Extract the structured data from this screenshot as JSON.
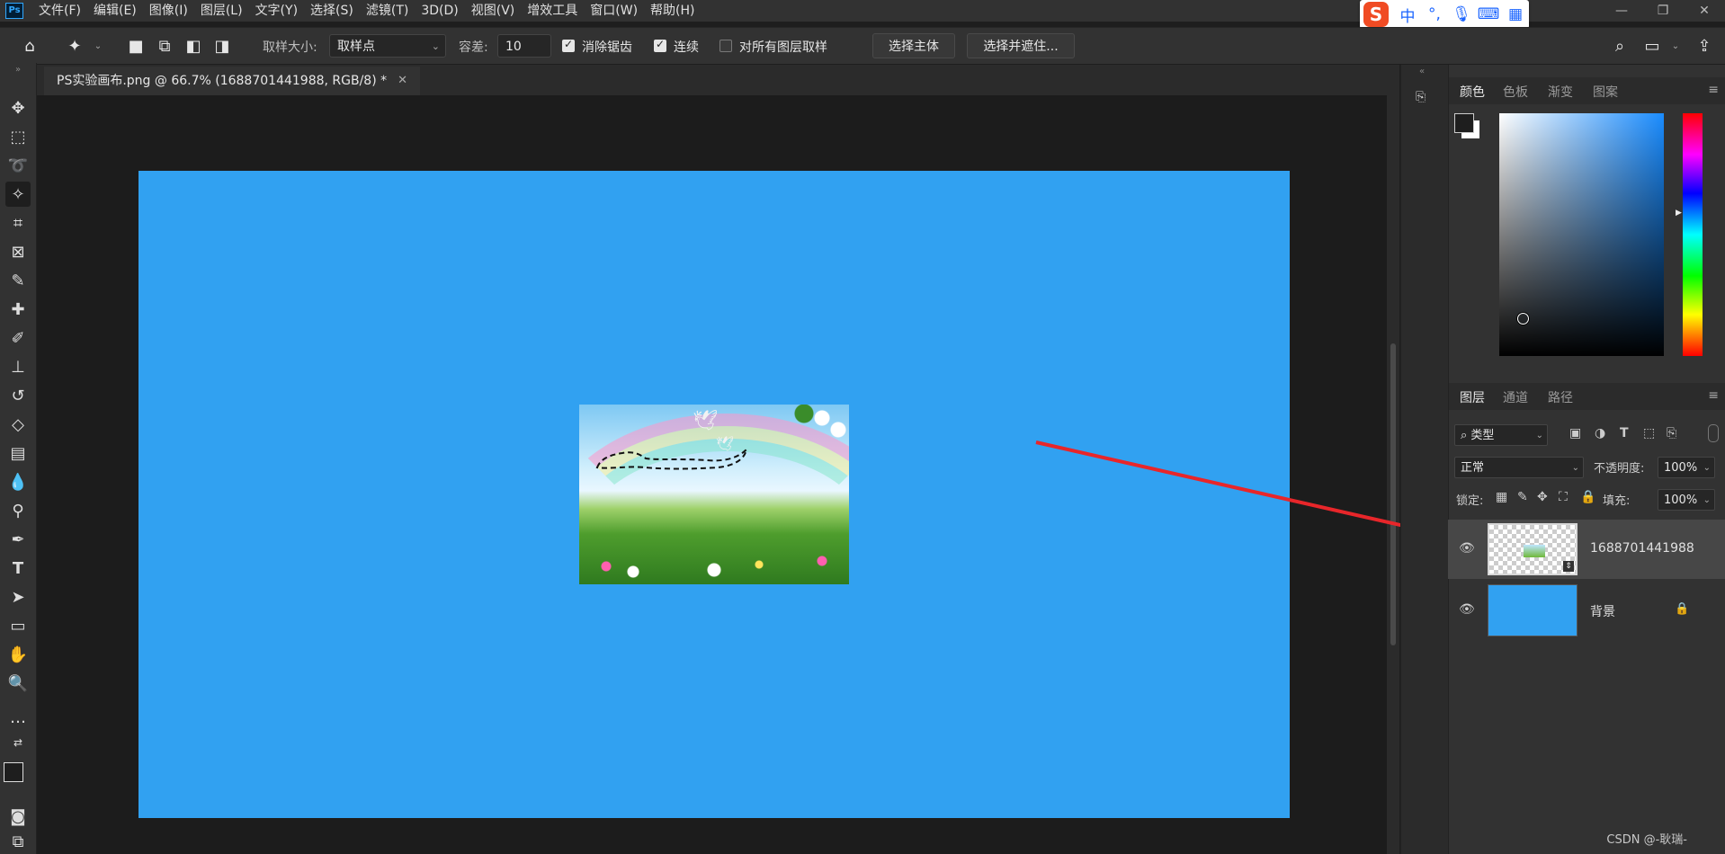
{
  "app": {
    "logo": "Ps"
  },
  "menu": [
    "文件(F)",
    "编辑(E)",
    "图像(I)",
    "图层(L)",
    "文字(Y)",
    "选择(S)",
    "滤镜(T)",
    "3D(D)",
    "视图(V)",
    "增效工具",
    "窗口(W)",
    "帮助(H)"
  ],
  "ime": {
    "logo": "S",
    "lang": "中",
    "punct": "°,"
  },
  "options": {
    "sample_size_label": "取样大小:",
    "sample_size_value": "取样点",
    "tolerance_label": "容差:",
    "tolerance_value": "10",
    "anti_alias_label": "消除锯齿",
    "anti_alias_checked": true,
    "contiguous_label": "连续",
    "contiguous_checked": true,
    "sample_all_label": "对所有图层取样",
    "sample_all_checked": false,
    "select_subject": "选择主体",
    "select_mask": "选择并遮住..."
  },
  "document": {
    "tab_title": "PS实验画布.png @ 66.7% (1688701441988, RGB/8) *",
    "canvas_color": "#31a1f1"
  },
  "color_panel": {
    "tabs": [
      "颜色",
      "色板",
      "渐变",
      "图案"
    ],
    "active": 0
  },
  "layers_panel": {
    "tabs": [
      "图层",
      "通道",
      "路径"
    ],
    "active": 0,
    "filter": "类型",
    "blend_mode": "正常",
    "opacity_label": "不透明度:",
    "opacity_value": "100%",
    "lock_label": "锁定:",
    "fill_label": "填充:",
    "fill_value": "100%",
    "layers": [
      {
        "name": "1688701441988",
        "selected": true
      },
      {
        "name": "背景",
        "locked": true
      }
    ]
  },
  "annotation": {
    "arrow_color": "#e8262a"
  },
  "watermark": "CSDN @-耿瑞-"
}
